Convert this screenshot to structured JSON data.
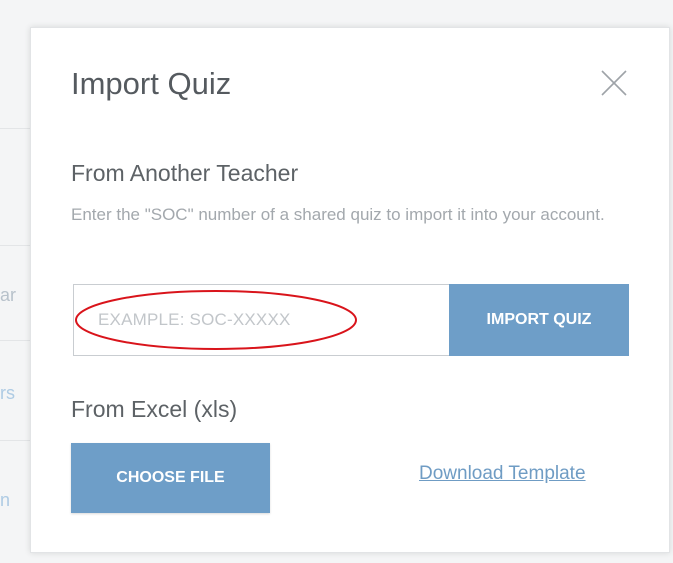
{
  "modal": {
    "title": "Import Quiz",
    "close_icon": "close-icon"
  },
  "from_teacher": {
    "heading": "From Another Teacher",
    "description": "Enter the \"SOC\" number of a shared quiz to import it into your account.",
    "input_placeholder": "EXAMPLE: SOC-XXXXX",
    "input_value": "",
    "import_button_label": "IMPORT QUIZ"
  },
  "from_excel": {
    "heading": "From Excel (xls)",
    "choose_button_label": "CHOOSE FILE",
    "download_link_label": "Download Template"
  },
  "colors": {
    "accent": "#6e9ec8",
    "annotation": "#d9141b",
    "link": "#6f9cc4"
  }
}
